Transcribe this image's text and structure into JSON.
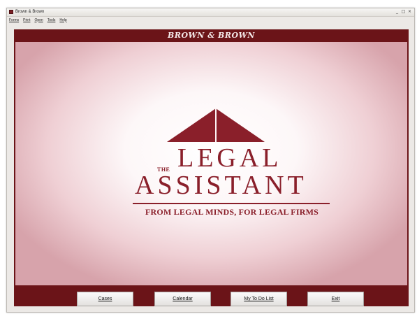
{
  "window": {
    "title": "Brown & Brown",
    "controls": [
      "_",
      "□",
      "×"
    ]
  },
  "menu": [
    "Forms",
    "Print",
    "Open",
    "Tools",
    "Help"
  ],
  "header": {
    "title": "BROWN & BROWN"
  },
  "logo": {
    "the": "THE",
    "line1": "LEGAL",
    "line2": "ASSISTANT",
    "tagline": "FROM LEGAL MINDS, FOR LEGAL FIRMS"
  },
  "buttons": {
    "cases": "Cases",
    "calendar": "Calendar",
    "todo": "My To Do List",
    "exit": "Exit"
  },
  "colors": {
    "brand": "#6b1418",
    "logo": "#8a1f2a"
  }
}
